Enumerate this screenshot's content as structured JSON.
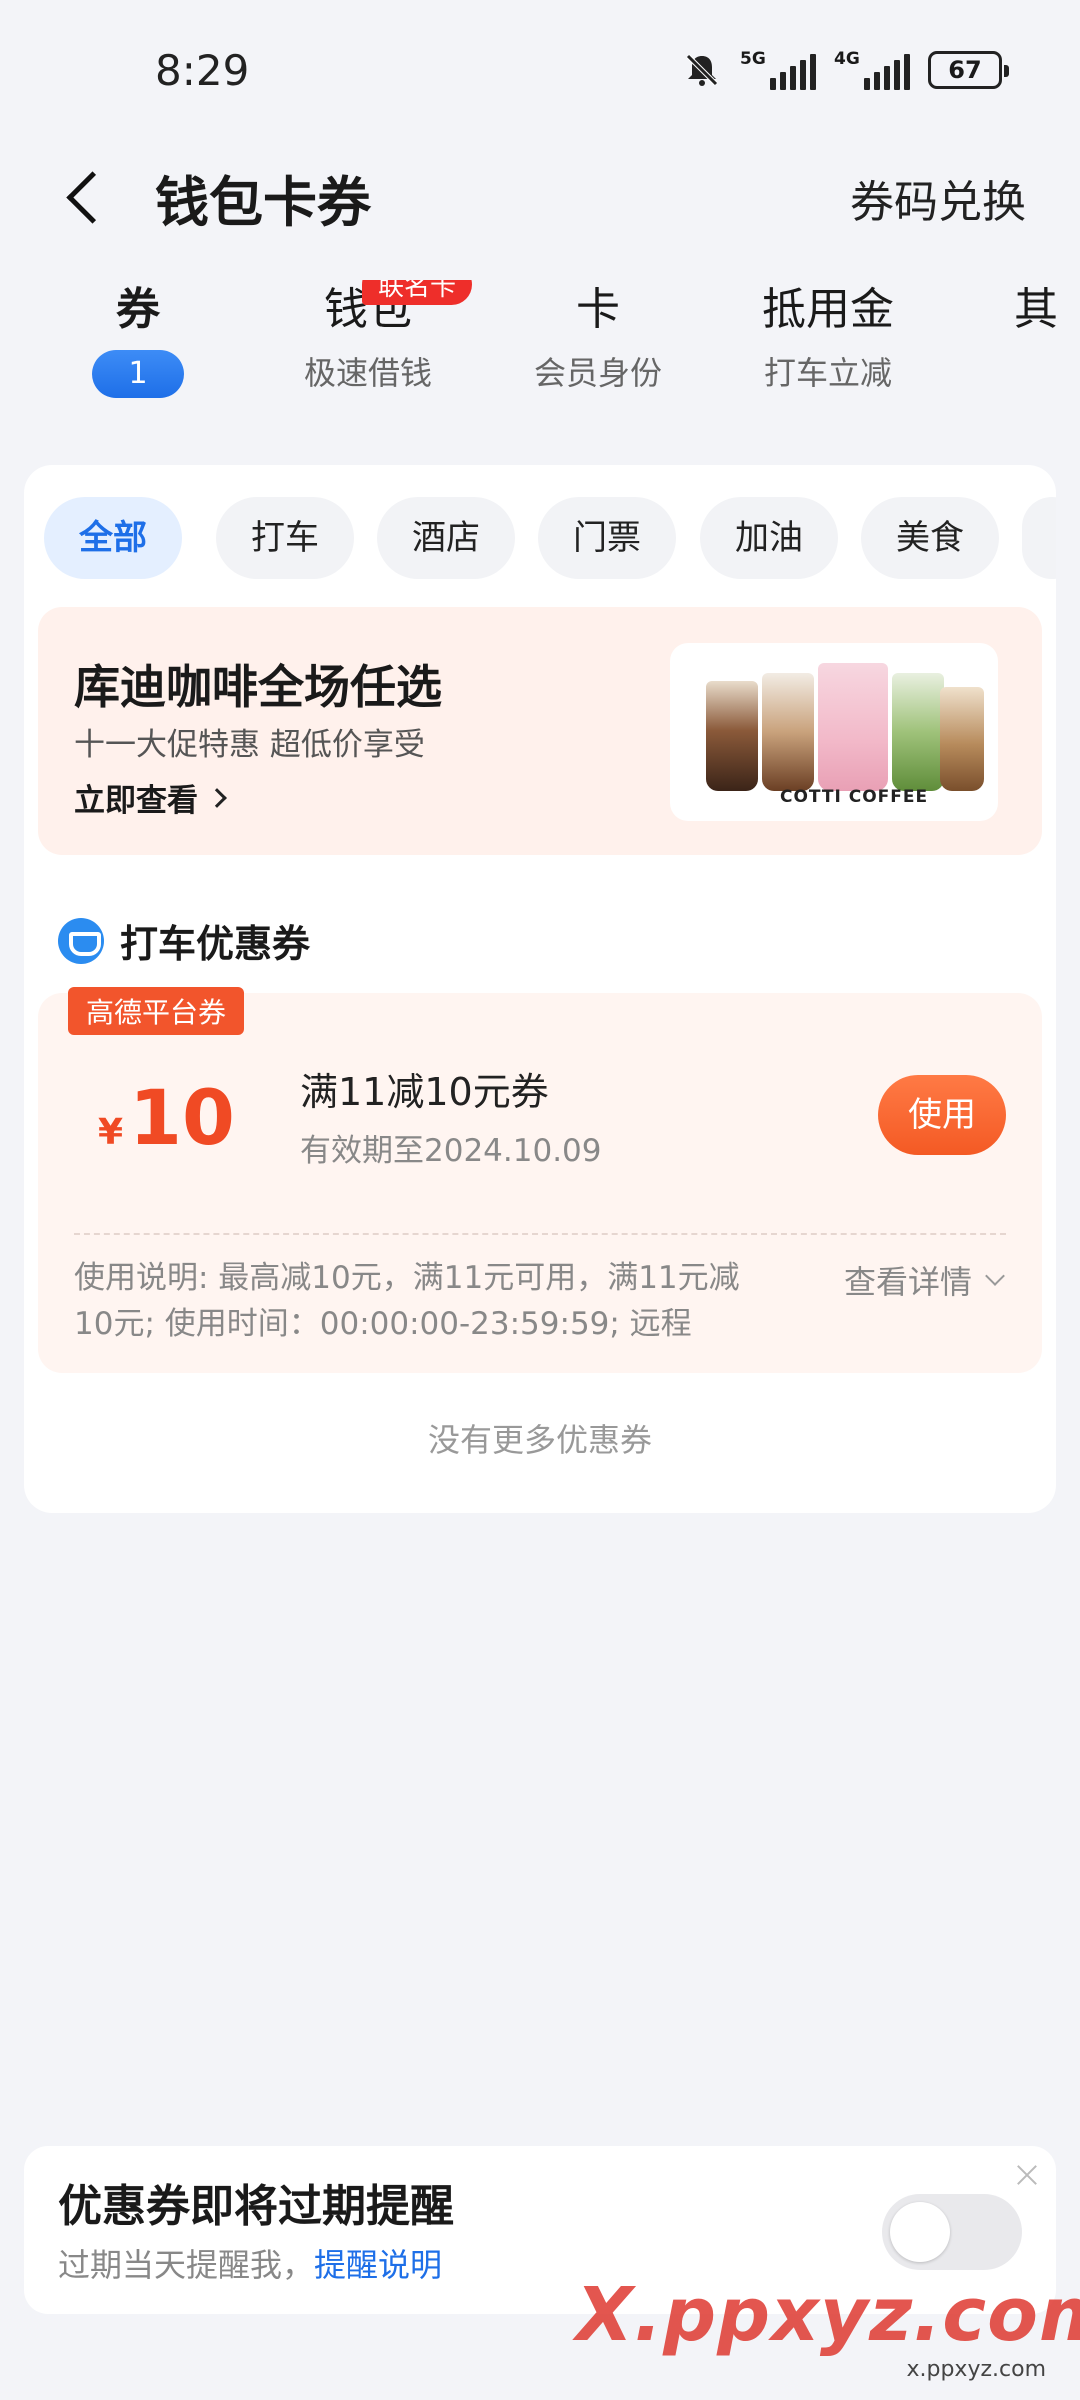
{
  "status_bar": {
    "time": "8:29",
    "net1": "5G",
    "net2": "4G",
    "battery": "67"
  },
  "header": {
    "title": "钱包卡券",
    "redeem": "券码兑换"
  },
  "top_tabs": [
    {
      "label": "券",
      "count": "1"
    },
    {
      "label": "钱包",
      "sub": "极速借钱",
      "badge": "联名卡"
    },
    {
      "label": "卡",
      "sub": "会员身份"
    },
    {
      "label": "抵用金",
      "sub": "打车立减"
    },
    {
      "label": "其"
    }
  ],
  "chips": [
    "全部",
    "打车",
    "酒店",
    "门票",
    "加油",
    "美食"
  ],
  "promo": {
    "title": "库迪咖啡全场任选",
    "subtitle": "十一大促特惠  超低价享受",
    "link": "立即查看",
    "brand": "COTTI COFFEE"
  },
  "section": {
    "title": "打车优惠券"
  },
  "coupon": {
    "tag": "高德平台券",
    "currency": "¥",
    "amount": "10",
    "name": "满11减10元券",
    "valid": "有效期至2024.10.09",
    "use": "使用",
    "desc": "使用说明: 最高减10元，满11元可用，满11元减10元; 使用时间：00:00:00-23:59:59; 远程",
    "detail": "查看详情"
  },
  "no_more": "没有更多优惠券",
  "reminder": {
    "title": "优惠券即将过期提醒",
    "sub": "过期当天提醒我，",
    "link": "提醒说明"
  },
  "watermark": {
    "main": "X.ppxyz.com",
    "small": "x.ppxyz.com"
  }
}
